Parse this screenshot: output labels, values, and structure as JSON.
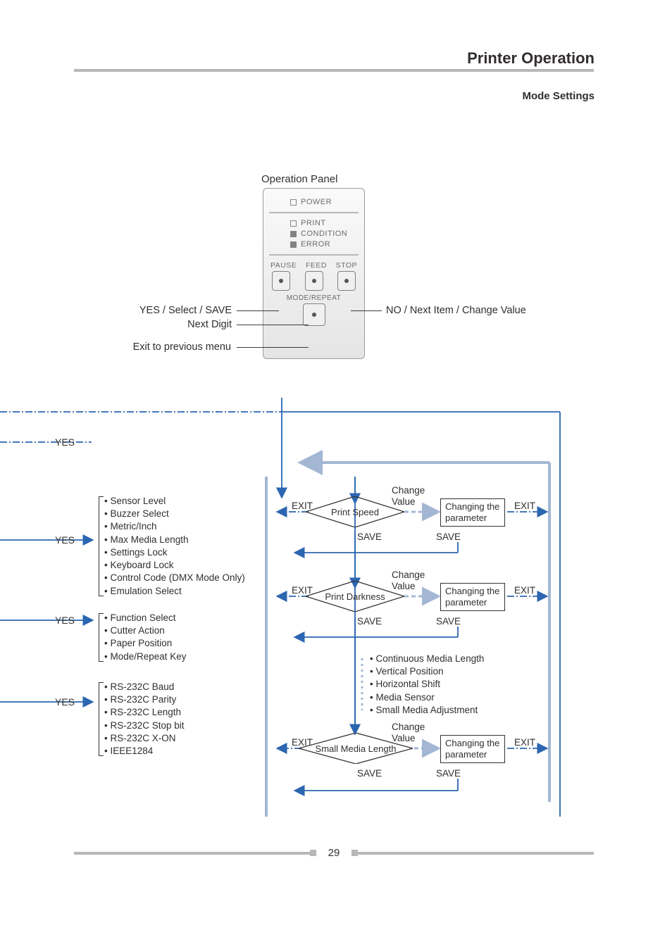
{
  "header": {
    "title": "Printer Operation",
    "section": "Mode Settings"
  },
  "panel": {
    "title": "Operation Panel",
    "leds": {
      "power": "POWER",
      "print": "PRINT",
      "condition": "CONDITION",
      "error": "ERROR"
    },
    "buttons": {
      "pause": "PAUSE",
      "feed": "FEED",
      "stop": "STOP",
      "mode_repeat": "MODE/REPEAT"
    },
    "callouts": {
      "yes_select_save": "YES / Select / SAVE",
      "next_digit": "Next Digit",
      "exit_prev_menu": "Exit to previous menu",
      "no_next_change": "NO / Next Item / Change Value"
    }
  },
  "flow": {
    "yes_labels": [
      "YES",
      "YES",
      "YES",
      "YES"
    ],
    "lists": {
      "list_a": [
        "Sensor Level",
        "Buzzer Select",
        "Metric/Inch",
        "Max Media Length",
        "Settings Lock",
        "Keyboard Lock",
        "Control Code (DMX Mode Only)",
        "Emulation Select"
      ],
      "list_b": [
        "Function Select",
        "Cutter Action",
        "Paper Position",
        "Mode/Repeat Key"
      ],
      "list_c": [
        "RS-232C Baud",
        "RS-232C Parity",
        "RS-232C Length",
        "RS-232C Stop bit",
        "RS-232C X-ON",
        "IEEE1284"
      ],
      "list_side": [
        "Continuous Media Length",
        "Vertical Position",
        "Horizontal Shift",
        "Media Sensor",
        "Small Media Adjustment"
      ]
    },
    "diamonds": {
      "d1": "Print Speed",
      "d2": "Print Darkness",
      "d3": "Small Media Length"
    },
    "change_box": {
      "text": "Changing the parameter",
      "line1": "Changing the",
      "line2": "parameter"
    },
    "labels": {
      "exit": "EXIT",
      "save": "SAVE",
      "change_value_l1": "Change",
      "change_value_l2": "Value"
    }
  },
  "footer": {
    "page": "29"
  }
}
